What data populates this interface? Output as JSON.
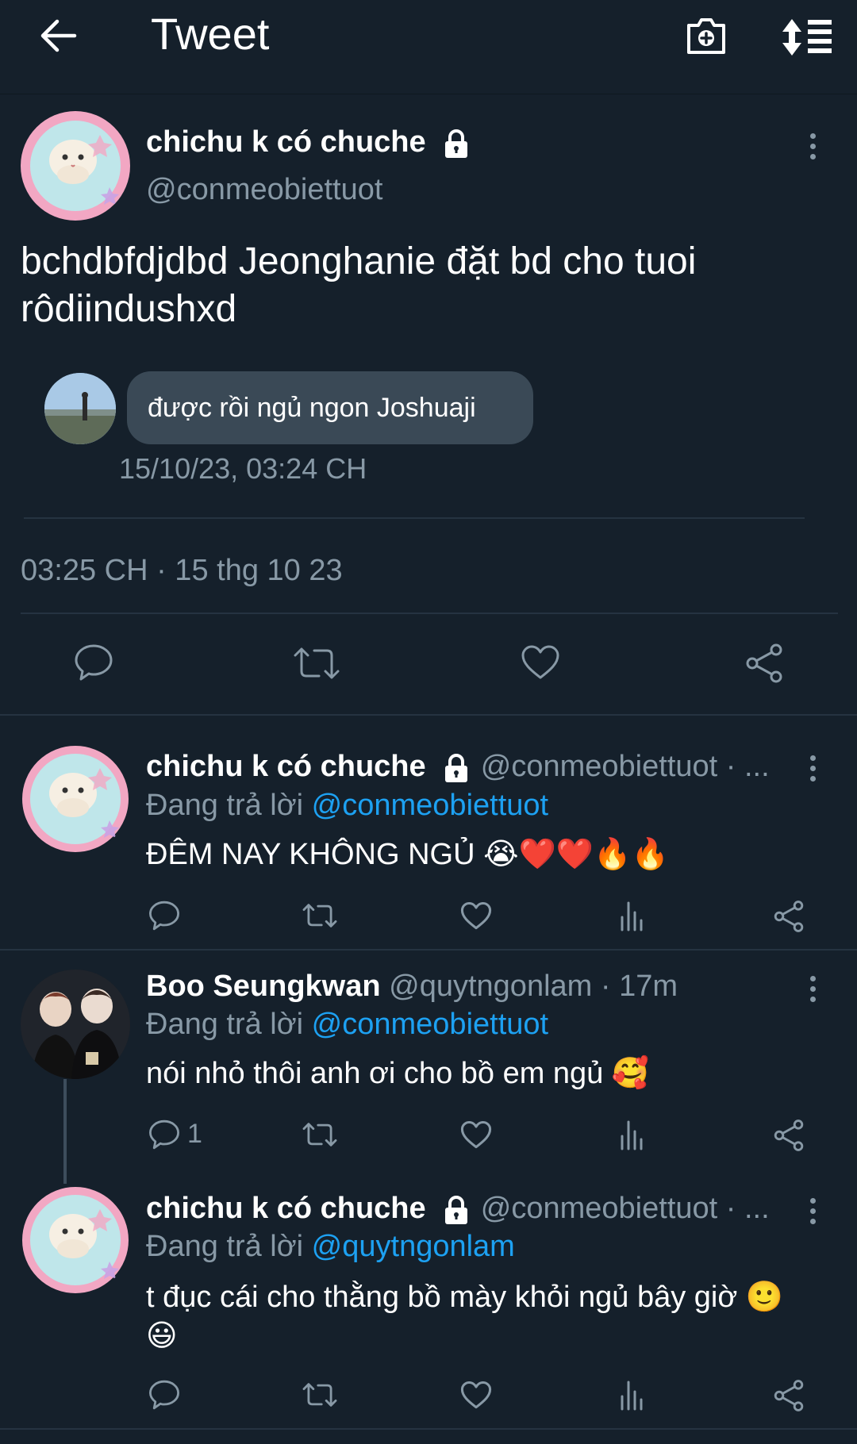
{
  "header": {
    "title": "Tweet"
  },
  "main_tweet": {
    "author_name": "chichu k có chuche",
    "handle": "@conmeobiettuot",
    "text_line1": "bchdbfdjdbd Jeonghanie đặt bd cho tuoi",
    "text_line2": "rôdiindushxd",
    "quoted_message": "được rồi ngủ ngon Joshuaji",
    "quoted_timestamp": "15/10/23, 03:24 CH",
    "timestamp": "03:25 CH · 15 thg 10 23"
  },
  "replies": [
    {
      "author_name": "chichu k có chuche",
      "handle_time": "@conmeobiettuot · ...",
      "replying_prefix": "Đang trả lời",
      "replying_to": "@conmeobiettuot",
      "text": "ĐÊM NAY KHÔNG NGỦ",
      "emojis": "😭❤️❤️🔥🔥",
      "reply_count": ""
    },
    {
      "author_name": "Boo Seungkwan",
      "handle_time": "@quytngonlam · 17m",
      "replying_prefix": "Đang trả lời",
      "replying_to": "@conmeobiettuot",
      "text": "nói nhỏ thôi anh ơi cho bồ em ngủ",
      "emojis": "🥰",
      "reply_count": "1"
    },
    {
      "author_name": "chichu k có chuche",
      "handle_time": "@conmeobiettuot · ...",
      "replying_prefix": "Đang trả lời",
      "replying_to": "@quytngonlam",
      "text": "t đục cái cho thằng bồ mày khỏi ngủ bây giờ",
      "emojis": "🙂",
      "emojis_line2": "😃",
      "reply_count": ""
    }
  ],
  "colors": {
    "background": "#15202b",
    "accent": "#1da1f2",
    "secondary_text": "#8899a6",
    "separator": "#253341"
  }
}
